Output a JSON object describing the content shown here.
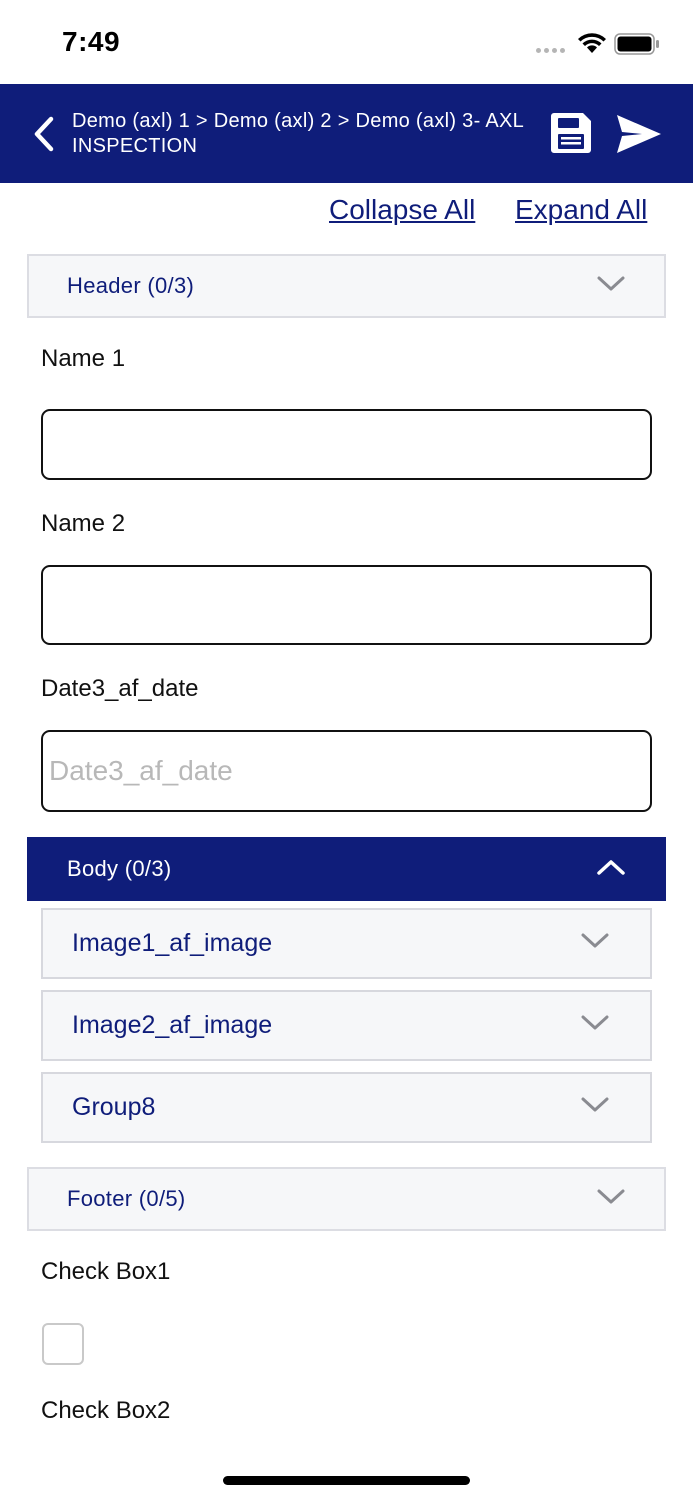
{
  "status_bar": {
    "time": "7:49"
  },
  "header": {
    "title": "Demo (axl) 1 > Demo (axl) 2 > Demo (axl) 3- AXL INSPECTION",
    "back_icon": "chevron-left-icon",
    "save_icon": "floppy-disk-icon",
    "send_icon": "paper-plane-icon"
  },
  "toolbar": {
    "collapse_all": "Collapse All",
    "expand_all": "Expand All"
  },
  "sections": {
    "header": {
      "label": "Header (0/3)"
    },
    "body": {
      "label": "Body (0/3)"
    },
    "footer": {
      "label": "Footer (0/5)"
    }
  },
  "fields": {
    "name1": {
      "label": "Name 1",
      "value": ""
    },
    "name2": {
      "label": "Name 2",
      "value": ""
    },
    "date3": {
      "label": "Date3_af_date",
      "placeholder": "Date3_af_date",
      "value": ""
    },
    "check_box1": {
      "label": "Check Box1",
      "checked": false
    },
    "check_box2": {
      "label": "Check Box2"
    }
  },
  "body_items": [
    {
      "label": "Image1_af_image"
    },
    {
      "label": "Image2_af_image"
    },
    {
      "label": "Group8"
    }
  ],
  "colors": {
    "brand": "#0f1d7a",
    "section_bg": "#f6f7f9",
    "border": "#dcdde3"
  }
}
